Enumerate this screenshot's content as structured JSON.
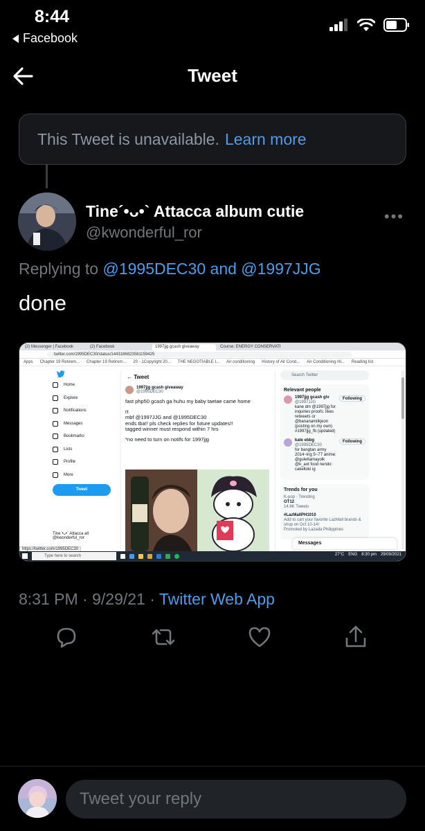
{
  "status_bar": {
    "time": "8:44",
    "back_app": "Facebook"
  },
  "header": {
    "title": "Tweet"
  },
  "unavailable": {
    "text": "This Tweet is unavailable.",
    "link": "Learn more"
  },
  "author": {
    "name": "Tine´•ᴗ•` Attacca album cutie",
    "handle": "@kwonderful_ror"
  },
  "replying": {
    "prefix": "Replying to",
    "mention1": "@1995DEC30",
    "and": "and",
    "mention2": "@1997JJG"
  },
  "tweet": {
    "text": "done",
    "time": "8:31 PM",
    "date": "9/29/21",
    "app": "Twitter Web App"
  },
  "embedded": {
    "tabs": [
      "(2) Messenger | Facebook",
      "(2) Facebook",
      "1997jjg gcash giveaway",
      "Course: ENERGY CONSERVATION"
    ],
    "url": "twitter.com/1995DEC30/status/1443186823581159425",
    "bookmarks": [
      "Apps",
      "Chapter 19 Retirem...",
      "Chapter 19 Retirem...",
      "20 - 1Copyright 20...",
      "THE NEGOTIABLE I...",
      "Air conditioning",
      "History of Air Cond...",
      "Air Conditioning Hi...",
      "Reading list"
    ],
    "nav": [
      "Home",
      "Explore",
      "Notifications",
      "Messages",
      "Bookmarks",
      "Lists",
      "Profile",
      "More"
    ],
    "tweet_button": "Tweet",
    "mini_profile_name": "Tine´•ᴗ•` Attacca all",
    "mini_profile_handle": "@kwonderful_ror",
    "main_title": "Tweet",
    "post_name": "1997jjg gcash giveaway",
    "post_handle": "@1995DEC30",
    "post_lines": [
      "fast php50 gcash ga huhu my baby taetae came home",
      "rt",
      "mbf @1997JJG and @1995DEC30",
      "ends tba!! pls check replies for future updates!!",
      "tagged winner must respond within 7 hrs",
      "*no need to turn on notifs for 1997jjg"
    ],
    "search_placeholder": "Search Twitter",
    "relevant_title": "Relevant people",
    "relevant": [
      {
        "name": "1997jjg gcash giv",
        "handle": "@1997JJG",
        "bio": "kane dm @1997jjg for inquiries proofs: likes retweets or @bananamilkjeon (posting on my own) #1997jjg_fb (updated)",
        "btn": "Following"
      },
      {
        "name": "kate ebbg",
        "handle": "@1995DEC30",
        "bio": "for bangtan army 2014~ing 5~77 anime: @gulettamayolk @k_aot food nendo: cakeltoki ig",
        "btn": "Following"
      }
    ],
    "trends_title": "Trends for you",
    "trends": [
      {
        "meta": "K-pop · Trending",
        "name": "OT12",
        "count": "14.6K Tweets"
      },
      {
        "meta": "",
        "name": "#LazMallPH1010",
        "count": "Add to cart your favorite LazMall brands & shop on Oct 10-14!"
      },
      {
        "meta": "",
        "name": "",
        "count": "Promoted by Lazada Philippines"
      }
    ],
    "messages": "Messages",
    "status_url": "https://twitter.com/1995DEC30",
    "taskbar_search": "Type here to search",
    "taskbar_weather": "27°C",
    "taskbar_lang": "ENG",
    "taskbar_time": "8:30 pm",
    "taskbar_date": "29/09/2021"
  },
  "reply": {
    "placeholder": "Tweet your reply"
  },
  "colors": {
    "accent": "#4c9eeb",
    "muted": "#71767b",
    "background": "#000000"
  }
}
